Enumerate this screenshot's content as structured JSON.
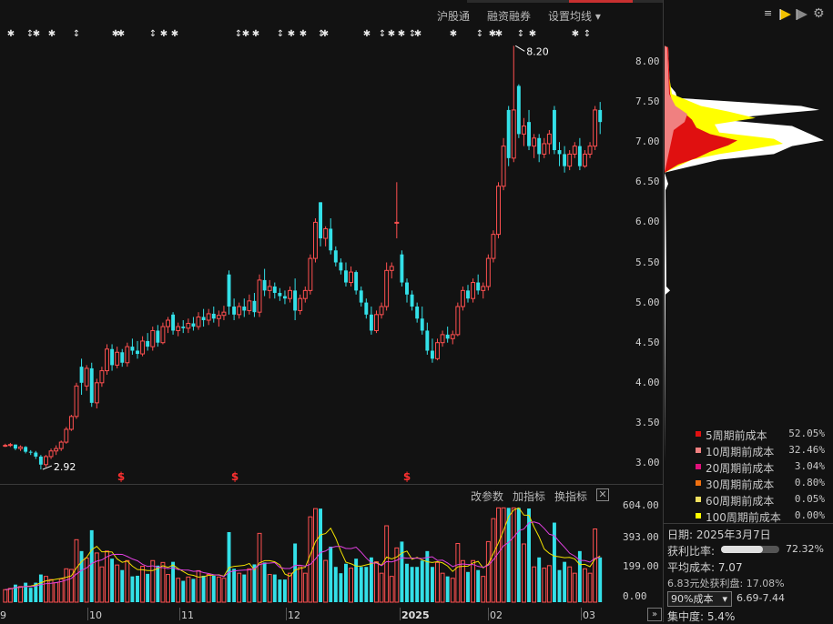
{
  "toolbar": {
    "hgt": "沪股通",
    "margin": "融资融券",
    "ma_settings": "设置均线"
  },
  "price_axis": [
    "8.00",
    "7.50",
    "7.00",
    "6.50",
    "6.00",
    "5.50",
    "5.00",
    "4.50",
    "4.00",
    "3.50",
    "3.00"
  ],
  "volume_axis": [
    "604.00",
    "393.00",
    "199.00",
    "0.00"
  ],
  "x_axis": [
    "9",
    "10",
    "11",
    "12",
    "2025",
    "02",
    "03"
  ],
  "annotations": {
    "high": "8.20",
    "low": "2.92",
    "dividend_marker": "$"
  },
  "indicator_buttons": {
    "params": "改参数",
    "add": "加指标",
    "switch": "换指标"
  },
  "chip_legend": [
    {
      "label": "5周期前成本",
      "pct": "52.05%",
      "color": "#e01010"
    },
    {
      "label": "10周期前成本",
      "pct": "32.46%",
      "color": "#f08080"
    },
    {
      "label": "20周期前成本",
      "pct": "3.04%",
      "color": "#e0107a"
    },
    {
      "label": "30周期前成本",
      "pct": "0.80%",
      "color": "#f07010"
    },
    {
      "label": "60周期前成本",
      "pct": "0.05%",
      "color": "#f0e060"
    },
    {
      "label": "100周期前成本",
      "pct": "0.00%",
      "color": "#ffff00"
    }
  ],
  "chip_info": {
    "date": "日期: 2025年3月7日",
    "profit_label": "获利比率:",
    "profit_value": "72.32%",
    "profit_ratio": 0.7232,
    "avg_cost": "平均成本: 7.07",
    "profit_at": "6.83元处获利盘: 17.08%",
    "range_select": "90%成本",
    "range_value": "6.69-7.44",
    "concentration": "集中度: 5.4%"
  },
  "chart_data": {
    "type": "candlestick",
    "x_labels": [
      "9",
      "10",
      "11",
      "12",
      "2025",
      "02",
      "03"
    ],
    "ylim": [
      2.85,
      8.3
    ],
    "high_label": 8.2,
    "low_label": 2.92,
    "candles": [
      [
        3.22,
        3.24,
        3.2,
        3.22
      ],
      [
        3.22,
        3.25,
        3.2,
        3.23
      ],
      [
        3.23,
        3.23,
        3.16,
        3.18
      ],
      [
        3.18,
        3.22,
        3.15,
        3.2
      ],
      [
        3.2,
        3.21,
        3.12,
        3.14
      ],
      [
        3.14,
        3.16,
        3.1,
        3.13
      ],
      [
        3.13,
        3.15,
        3.05,
        3.08
      ],
      [
        3.08,
        3.1,
        2.92,
        2.98
      ],
      [
        2.98,
        3.1,
        2.95,
        3.08
      ],
      [
        3.08,
        3.18,
        3.05,
        3.15
      ],
      [
        3.15,
        3.22,
        3.1,
        3.18
      ],
      [
        3.18,
        3.28,
        3.15,
        3.26
      ],
      [
        3.26,
        3.45,
        3.24,
        3.42
      ],
      [
        3.42,
        3.6,
        3.4,
        3.58
      ],
      [
        3.58,
        4.0,
        3.55,
        3.96
      ],
      [
        4.2,
        4.3,
        3.85,
        4.0
      ],
      [
        3.96,
        4.22,
        3.9,
        4.18
      ],
      [
        4.18,
        4.25,
        3.7,
        3.75
      ],
      [
        3.75,
        4.05,
        3.68,
        4.0
      ],
      [
        4.0,
        4.2,
        3.95,
        4.15
      ],
      [
        4.15,
        4.48,
        4.1,
        4.42
      ],
      [
        4.42,
        4.48,
        4.15,
        4.22
      ],
      [
        4.22,
        4.45,
        4.18,
        4.38
      ],
      [
        4.38,
        4.42,
        4.2,
        4.25
      ],
      [
        4.25,
        4.5,
        4.2,
        4.45
      ],
      [
        4.45,
        4.55,
        4.35,
        4.4
      ],
      [
        4.4,
        4.52,
        4.3,
        4.36
      ],
      [
        4.36,
        4.58,
        4.33,
        4.52
      ],
      [
        4.52,
        4.62,
        4.4,
        4.45
      ],
      [
        4.45,
        4.7,
        4.4,
        4.65
      ],
      [
        4.65,
        4.72,
        4.45,
        4.5
      ],
      [
        4.5,
        4.75,
        4.48,
        4.7
      ],
      [
        4.7,
        4.82,
        4.62,
        4.78
      ],
      [
        4.85,
        4.88,
        4.6,
        4.65
      ],
      [
        4.65,
        4.75,
        4.58,
        4.7
      ],
      [
        4.7,
        4.78,
        4.62,
        4.68
      ],
      [
        4.68,
        4.8,
        4.62,
        4.74
      ],
      [
        4.74,
        4.82,
        4.65,
        4.7
      ],
      [
        4.7,
        4.88,
        4.66,
        4.82
      ],
      [
        4.82,
        4.92,
        4.7,
        4.78
      ],
      [
        4.78,
        4.92,
        4.72,
        4.86
      ],
      [
        4.86,
        4.95,
        4.75,
        4.8
      ],
      [
        4.8,
        4.9,
        4.7,
        4.84
      ],
      [
        4.84,
        4.96,
        4.78,
        4.88
      ],
      [
        5.35,
        5.4,
        4.85,
        4.95
      ],
      [
        4.95,
        5.05,
        4.78,
        4.85
      ],
      [
        4.85,
        5.0,
        4.8,
        4.95
      ],
      [
        4.95,
        5.05,
        4.82,
        4.9
      ],
      [
        4.9,
        5.1,
        4.85,
        5.02
      ],
      [
        5.02,
        5.12,
        4.82,
        4.88
      ],
      [
        4.88,
        5.35,
        4.82,
        5.28
      ],
      [
        5.28,
        5.42,
        5.08,
        5.15
      ],
      [
        5.15,
        5.28,
        5.05,
        5.2
      ],
      [
        5.2,
        5.25,
        5.05,
        5.12
      ],
      [
        5.12,
        5.18,
        5.02,
        5.08
      ],
      [
        5.08,
        5.15,
        4.98,
        5.05
      ],
      [
        5.05,
        5.2,
        5.0,
        5.15
      ],
      [
        5.15,
        5.3,
        4.78,
        4.9
      ],
      [
        4.9,
        5.1,
        4.85,
        5.05
      ],
      [
        5.05,
        5.2,
        5.0,
        5.15
      ],
      [
        5.15,
        5.6,
        5.1,
        5.55
      ],
      [
        5.55,
        6.05,
        5.5,
        6.0
      ],
      [
        6.25,
        6.25,
        5.7,
        5.8
      ],
      [
        5.8,
        5.95,
        5.7,
        5.92
      ],
      [
        5.92,
        6.05,
        5.6,
        5.65
      ],
      [
        5.65,
        5.7,
        5.45,
        5.5
      ],
      [
        5.5,
        5.55,
        5.35,
        5.4
      ],
      [
        5.4,
        5.5,
        5.2,
        5.25
      ],
      [
        5.25,
        5.45,
        5.2,
        5.38
      ],
      [
        5.38,
        5.4,
        5.1,
        5.15
      ],
      [
        5.15,
        5.2,
        4.95,
        5.0
      ],
      [
        5.0,
        5.05,
        4.8,
        4.85
      ],
      [
        4.85,
        4.95,
        4.6,
        4.65
      ],
      [
        4.65,
        4.9,
        4.62,
        4.85
      ],
      [
        4.85,
        5.0,
        4.8,
        4.95
      ],
      [
        4.95,
        5.5,
        4.9,
        5.4
      ],
      [
        5.4,
        5.5,
        5.3,
        5.45
      ],
      [
        6.0,
        6.5,
        5.8,
        6.0
      ],
      [
        5.6,
        5.65,
        5.2,
        5.25
      ],
      [
        5.25,
        5.3,
        5.0,
        5.1
      ],
      [
        5.1,
        5.15,
        4.9,
        4.95
      ],
      [
        4.95,
        5.0,
        4.75,
        4.8
      ],
      [
        4.8,
        4.95,
        4.6,
        4.65
      ],
      [
        4.65,
        4.75,
        4.35,
        4.4
      ],
      [
        4.4,
        4.55,
        4.25,
        4.3
      ],
      [
        4.3,
        4.55,
        4.28,
        4.5
      ],
      [
        4.5,
        4.65,
        4.45,
        4.6
      ],
      [
        4.6,
        4.7,
        4.5,
        4.55
      ],
      [
        4.55,
        4.65,
        4.48,
        4.6
      ],
      [
        4.6,
        5.0,
        4.58,
        4.95
      ],
      [
        4.95,
        5.2,
        4.9,
        5.15
      ],
      [
        5.15,
        5.22,
        5.0,
        5.05
      ],
      [
        5.05,
        5.3,
        5.0,
        5.25
      ],
      [
        5.25,
        5.35,
        5.1,
        5.15
      ],
      [
        5.15,
        5.25,
        5.05,
        5.2
      ],
      [
        5.2,
        5.6,
        5.15,
        5.55
      ],
      [
        5.55,
        5.9,
        5.5,
        5.85
      ],
      [
        5.85,
        6.5,
        5.8,
        6.45
      ],
      [
        6.45,
        7.05,
        6.4,
        6.95
      ],
      [
        7.4,
        7.45,
        6.7,
        6.8
      ],
      [
        6.8,
        8.2,
        6.75,
        7.4
      ],
      [
        7.7,
        7.72,
        7.05,
        7.1
      ],
      [
        7.1,
        7.3,
        6.95,
        7.2
      ],
      [
        7.25,
        7.4,
        6.9,
        6.95
      ],
      [
        6.95,
        7.1,
        6.8,
        7.05
      ],
      [
        7.05,
        7.1,
        6.75,
        6.85
      ],
      [
        6.85,
        7.05,
        6.8,
        6.98
      ],
      [
        6.98,
        7.15,
        6.85,
        7.1
      ],
      [
        7.4,
        7.45,
        6.85,
        6.9
      ],
      [
        6.9,
        7.0,
        6.7,
        6.85
      ],
      [
        6.85,
        6.95,
        6.62,
        6.7
      ],
      [
        6.7,
        6.9,
        6.65,
        6.85
      ],
      [
        6.85,
        7.0,
        6.8,
        6.95
      ],
      [
        6.95,
        7.05,
        6.65,
        6.7
      ],
      [
        6.7,
        6.9,
        6.68,
        6.85
      ],
      [
        6.85,
        7.0,
        6.8,
        6.95
      ],
      [
        6.95,
        7.45,
        6.9,
        7.4
      ],
      [
        7.4,
        7.5,
        7.1,
        7.25
      ]
    ],
    "volume_scale": [
      0,
      620
    ]
  }
}
